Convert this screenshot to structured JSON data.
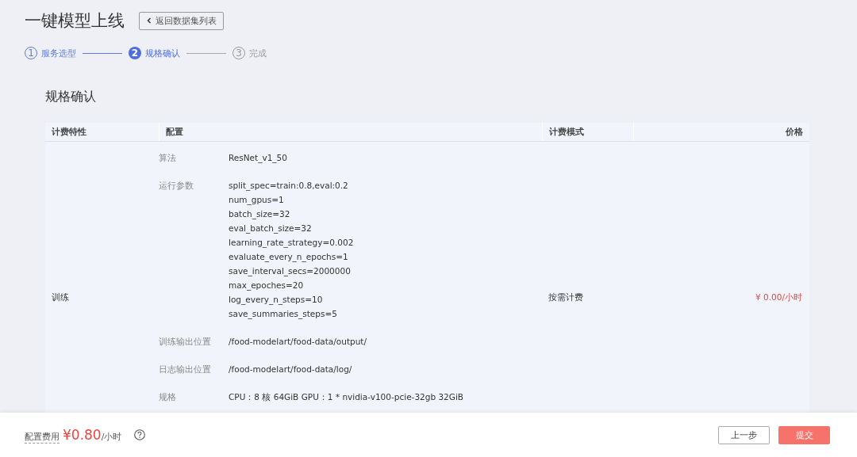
{
  "page": {
    "title": "一键模型上线",
    "back_button": "返回数据集列表"
  },
  "steps": [
    {
      "number": "1",
      "label": "服务选型",
      "completed": true,
      "selected": false
    },
    {
      "number": "2",
      "label": "规格确认",
      "completed": false,
      "selected": true
    },
    {
      "number": "3",
      "label": "完成",
      "completed": false,
      "selected": false
    }
  ],
  "section_title": "规格确认",
  "table": {
    "columns": [
      "计费特性",
      "配置",
      "计费模式",
      "价格"
    ],
    "rows": [
      {
        "feature": "训练",
        "billing_mode": "按需计费",
        "price": "¥ 0.00/小时",
        "config": [
          {
            "label": "算法",
            "values": [
              "ResNet_v1_50"
            ]
          },
          {
            "label": "运行参数",
            "values": [
              "split_spec=train:0.8,eval:0.2",
              "num_gpus=1",
              "batch_size=32",
              "eval_batch_size=32",
              "learning_rate_strategy=0.002",
              "evaluate_every_n_epochs=1",
              "save_interval_secs=2000000",
              "max_epoches=20",
              "log_every_n_steps=10",
              "save_summaries_steps=5"
            ]
          },
          {
            "label": "训练输出位置",
            "values": [
              "/food-modelart/food-data/output/"
            ]
          },
          {
            "label": "日志输出位置",
            "values": [
              "/food-modelart/food-data/log/"
            ]
          },
          {
            "label": "规格",
            "values": [
              "CPU：8 核 64GiB GPU：1 * nvidia-v100-pcie-32gb 32GiB"
            ]
          }
        ]
      }
    ]
  },
  "footer": {
    "fee_label": "配置费用",
    "fee_amount": "¥0.80",
    "fee_unit": "/小时"
  },
  "buttons": [
    {
      "label": "上一步",
      "kind": "secondary"
    },
    {
      "label": "提交",
      "kind": "primary"
    }
  ]
}
